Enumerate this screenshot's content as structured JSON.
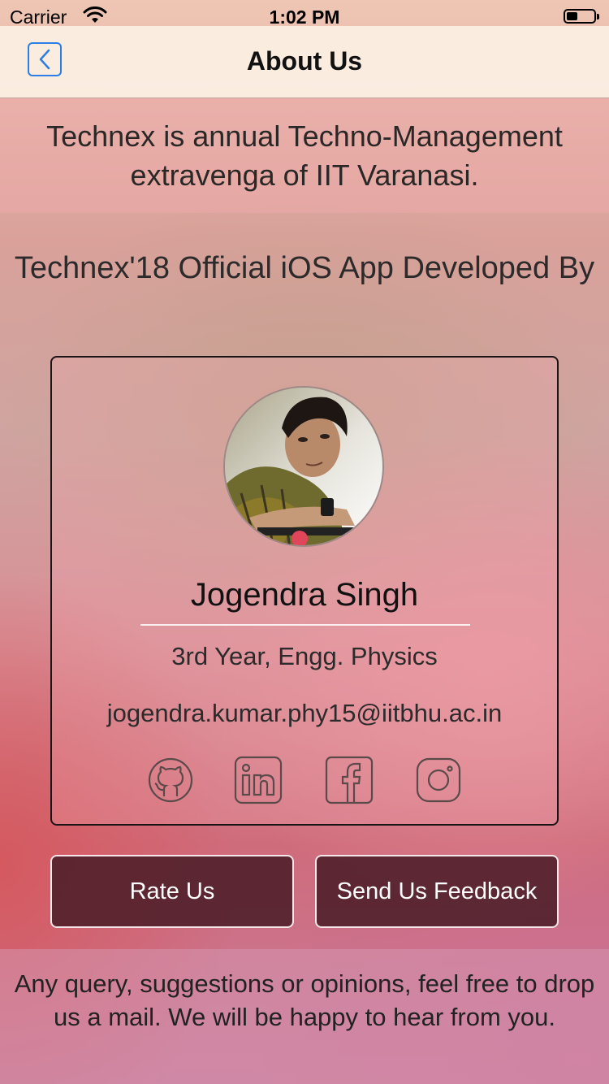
{
  "status_bar": {
    "carrier": "Carrier",
    "time": "1:02 PM",
    "battery_level": 0.4
  },
  "navbar": {
    "title": "About Us",
    "back_icon": "chevron-left-icon",
    "accent": "#2a7ee6"
  },
  "intro": {
    "text": "Technex is annual Techno-Management extravenga of IIT Varanasi."
  },
  "developer_section": {
    "heading": "Technex'18 Official iOS App Developed By",
    "name": "Jogendra Singh",
    "year": "3rd Year, Engg. Physics",
    "email": "jogendra.kumar.phy15@iitbhu.ac.in",
    "social_icons": [
      "github-icon",
      "linkedin-icon",
      "facebook-icon",
      "instagram-icon"
    ]
  },
  "buttons": {
    "rate": "Rate Us",
    "feedback": "Send Us Feedback"
  },
  "footer": {
    "text": "Any query, suggestions or opinions, feel free to drop us a mail. We will be happy to hear from you."
  }
}
